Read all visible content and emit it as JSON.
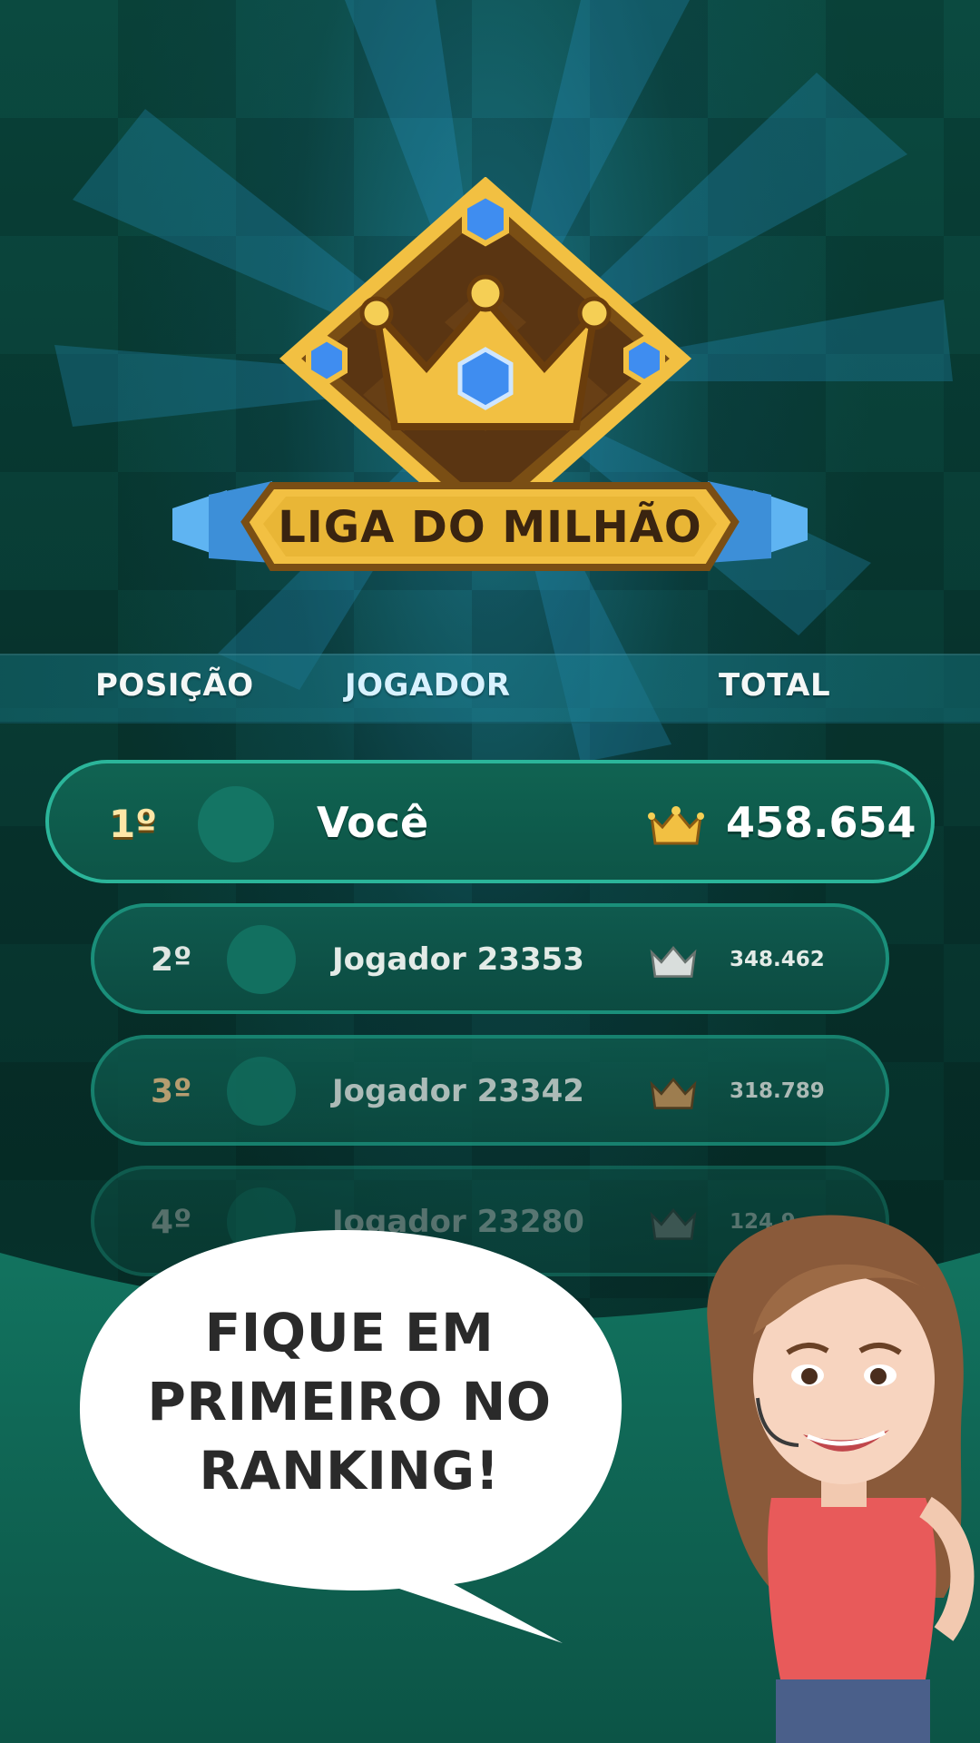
{
  "emblem": {
    "title": "LIGA DO MILHÃO"
  },
  "table_header": {
    "position": "POSIÇÃO",
    "player": "JOGADOR",
    "total": "TOTAL"
  },
  "ranking": [
    {
      "rank": "1º",
      "name": "Você",
      "score": "458.654"
    },
    {
      "rank": "2º",
      "name": "Jogador 23353",
      "score": "348.462"
    },
    {
      "rank": "3º",
      "name": "Jogador 23342",
      "score": "318.789"
    },
    {
      "rank": "4º",
      "name": "Jogador 23280",
      "score": "124.9"
    }
  ],
  "bubble": {
    "line1": "FIQUE EM",
    "line2": "PRIMEIRO NO",
    "line3": "RANKING!"
  },
  "colors": {
    "gold": "#f2c042",
    "gem_blue": "#3f8df0",
    "teal_row": "#1a8f7a",
    "background": "#0a3b33"
  }
}
